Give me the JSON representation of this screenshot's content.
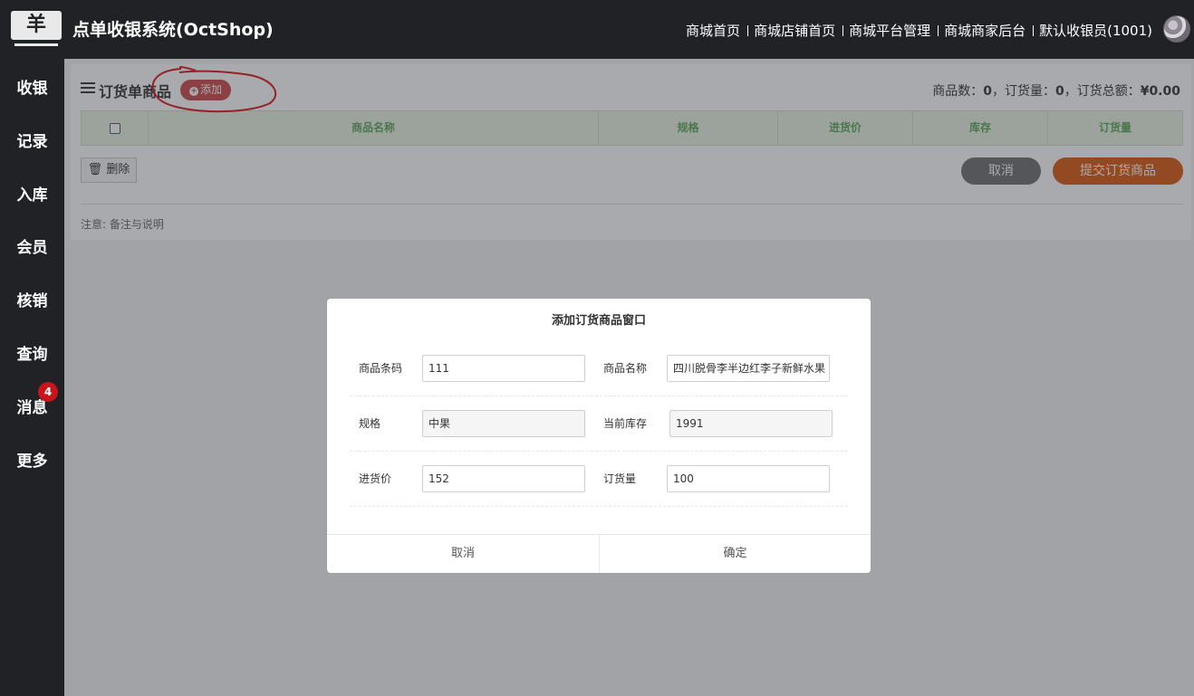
{
  "app": {
    "logo_glyph": "羊",
    "title": "点单收银系统(OctShop)"
  },
  "topnav": {
    "links": [
      "商城首页",
      "商城店铺首页",
      "商城平台管理",
      "商城商家后台",
      "默认收银员(1001)"
    ]
  },
  "sidebar": {
    "items": [
      {
        "label": "收银"
      },
      {
        "label": "记录"
      },
      {
        "label": "入库"
      },
      {
        "label": "会员"
      },
      {
        "label": "核销"
      },
      {
        "label": "查询"
      },
      {
        "label": "消息",
        "badge": "4"
      },
      {
        "label": "更多"
      }
    ]
  },
  "panel": {
    "title": "订货单商品",
    "add_label": "添加",
    "summary": {
      "goods_label": "商品数：",
      "goods_value": "0",
      "qty_label": "，订货量：",
      "qty_value": "0",
      "amount_label": "，订货总额：",
      "amount_value": "¥0.00"
    },
    "columns": [
      "商品名称",
      "规格",
      "进货价",
      "库存",
      "订货量"
    ],
    "delete_label": "删除",
    "cancel_label": "取消",
    "submit_label": "提交订货商品",
    "note": "注意: 备注与说明"
  },
  "modal": {
    "title": "添加订货商品窗口",
    "fields": {
      "barcode": {
        "label": "商品条码",
        "value": "111"
      },
      "name": {
        "label": "商品名称",
        "value": "四川脱骨李半边红李子新鲜水果"
      },
      "spec": {
        "label": "规格",
        "value": "中果"
      },
      "stock": {
        "label": "当前库存",
        "value": "1991"
      },
      "price": {
        "label": "进货价",
        "value": "152"
      },
      "qty": {
        "label": "订货量",
        "value": "100"
      }
    },
    "cancel_label": "取消",
    "confirm_label": "确定"
  },
  "colors": {
    "topbar": "#202226",
    "add_button": "#cc4a4a",
    "submit_button": "#d95a12",
    "table_header_text": "#5fa65a",
    "badge": "#c9141b"
  }
}
